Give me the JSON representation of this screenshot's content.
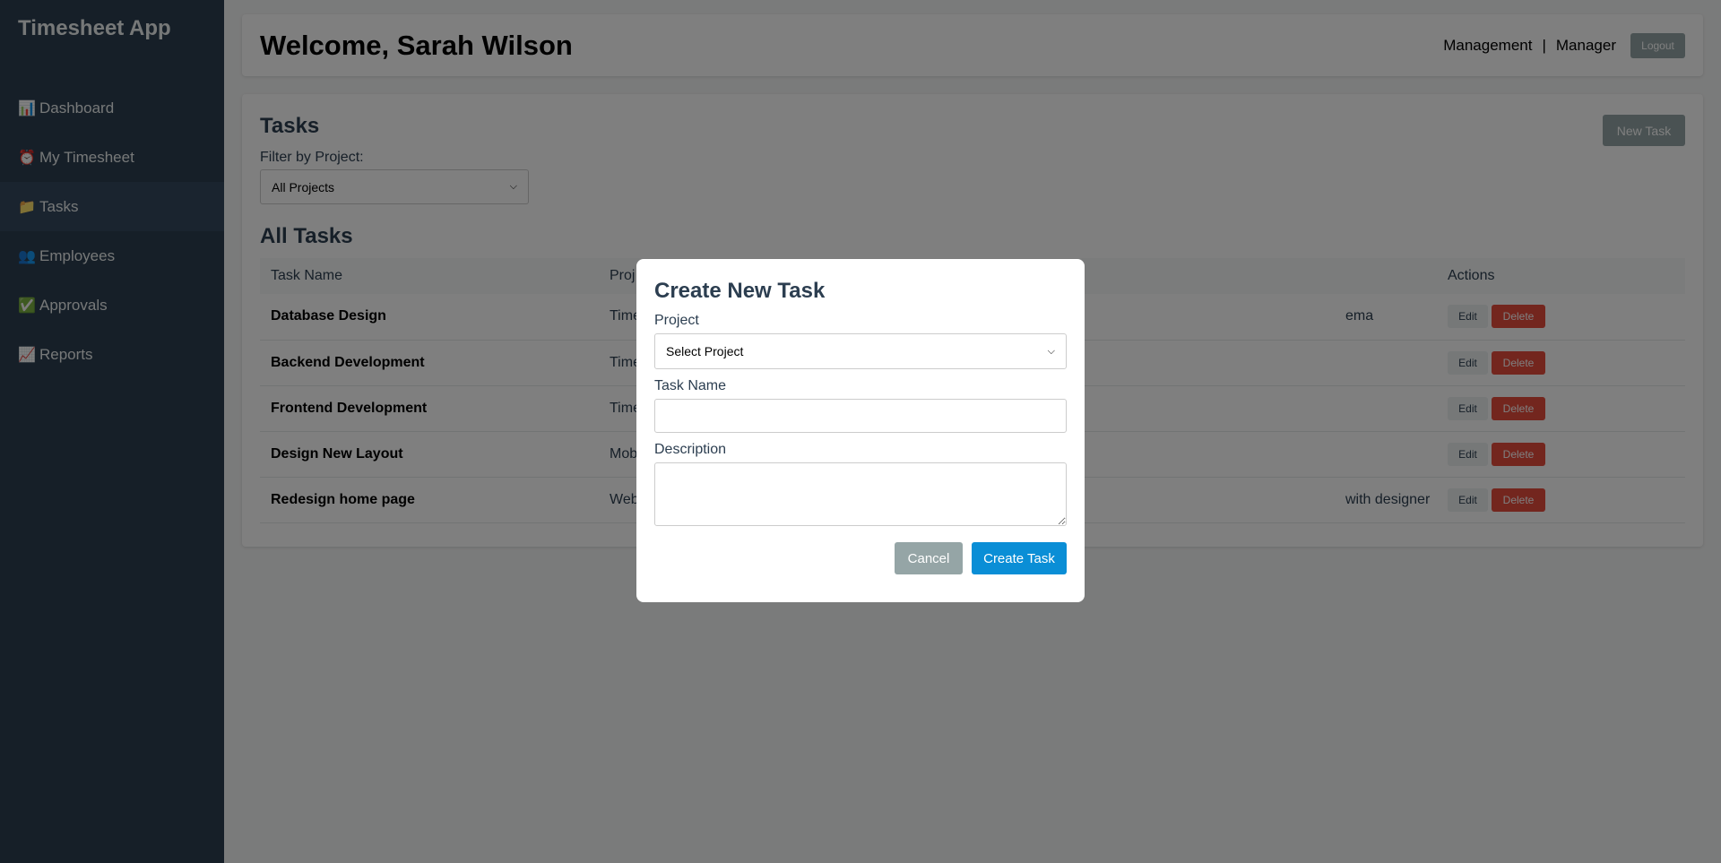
{
  "app": {
    "title": "Timesheet App"
  },
  "sidebar": {
    "items": [
      {
        "icon": "📊",
        "icon_name": "chart-icon",
        "label": "Dashboard"
      },
      {
        "icon": "⏰",
        "icon_name": "alarm-clock-icon",
        "label": "My Timesheet"
      },
      {
        "icon": "📁",
        "icon_name": "folder-icon",
        "label": "Tasks",
        "active": true
      },
      {
        "icon": "👥",
        "icon_name": "users-icon",
        "label": "Employees"
      },
      {
        "icon": "✅",
        "icon_name": "check-icon",
        "label": "Approvals"
      },
      {
        "icon": "📈",
        "icon_name": "trend-icon",
        "label": "Reports"
      }
    ]
  },
  "header": {
    "welcome": "Welcome, Sarah Wilson",
    "department": "Management",
    "separator": "|",
    "role": "Manager",
    "logout_label": "Logout"
  },
  "tasks": {
    "title": "Tasks",
    "new_task_label": "New Task",
    "filter_label": "Filter by Project:",
    "filter_value": "All Projects",
    "all_tasks_title": "All Tasks",
    "columns": [
      "Task Name",
      "Proj",
      "Actions"
    ],
    "rows": [
      {
        "name": "Database Design",
        "project": "Time",
        "description": "ema"
      },
      {
        "name": "Backend Development",
        "project": "Time",
        "description": ""
      },
      {
        "name": "Frontend Development",
        "project": "Time",
        "description": ""
      },
      {
        "name": "Design New Layout",
        "project": "Mob",
        "description": ""
      },
      {
        "name": "Redesign home page",
        "project": "Web",
        "description": "with designer"
      }
    ],
    "edit_label": "Edit",
    "delete_label": "Delete"
  },
  "modal": {
    "title": "Create New Task",
    "project_label": "Project",
    "project_value": "Select Project",
    "task_name_label": "Task Name",
    "task_name_value": "",
    "description_label": "Description",
    "description_value": "",
    "cancel_label": "Cancel",
    "create_label": "Create Task"
  },
  "colors": {
    "sidebar_bg": "#2c3e50",
    "primary": "#0a8ed6",
    "danger": "#e74c3c",
    "muted_button": "#95a5a6"
  }
}
